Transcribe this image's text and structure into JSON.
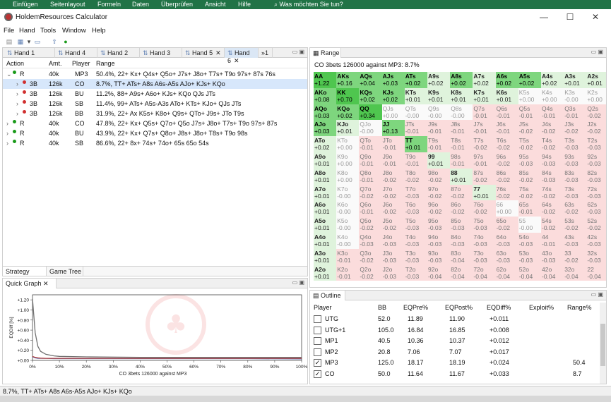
{
  "excel_ribbon": [
    "Einfügen",
    "Seitenlayout",
    "Formeln",
    "Daten",
    "Überprüfen",
    "Ansicht",
    "Hilfe",
    "Was möchten Sie tun?"
  ],
  "window_title": "HoldemResources Calculator",
  "menu": [
    "File",
    "Hand",
    "Tools",
    "Window",
    "Help"
  ],
  "hand_tabs": [
    "Hand 1",
    "Hand 4",
    "Hand 2",
    "Hand 3",
    "Hand 5",
    "Hand 6",
    "»1"
  ],
  "hands_table": {
    "columns": [
      "Action",
      "Amt.",
      "Player",
      "Range"
    ],
    "rows": [
      {
        "action": "R",
        "amt": "40k",
        "player": "MP3",
        "range": "50.4%, 22+ Kx+ Q4s+ Q5o+ J7s+ J8o+ T7s+ T9o 97s+ 87s 76s",
        "indent": 0,
        "expander": "⌄",
        "dot": "#1a9a1a"
      },
      {
        "action": "3B",
        "amt": "126k",
        "player": "CO",
        "range": "8.7%, TT+ ATs+ A8s A6s-A5s AJo+ KJs+ KQo",
        "indent": 1,
        "expander": "›",
        "dot": "#d03030"
      },
      {
        "action": "3B",
        "amt": "126k",
        "player": "BU",
        "range": "11.2%, 88+ A9s+ A6o+ KJs+ KQo QJs JTs",
        "indent": 1,
        "expander": "›",
        "dot": "#d03030"
      },
      {
        "action": "3B",
        "amt": "126k",
        "player": "SB",
        "range": "11.4%, 99+ ATs+ A5s-A3s ATo+ KTs+ KJo+ QJs JTs",
        "indent": 1,
        "expander": "›",
        "dot": "#d03030"
      },
      {
        "action": "3B",
        "amt": "126k",
        "player": "BB",
        "range": "31.9%, 22+ Ax K5s+ K8o+ Q9s+ QTo+ J9s+ JTo T9s",
        "indent": 1,
        "expander": "›",
        "dot": "#d03030"
      },
      {
        "action": "R",
        "amt": "40k",
        "player": "CO",
        "range": "47.8%, 22+ Kx+ Q5s+ Q7o+ Q5o J7s+ J8o+ T7s+ T9o 97s+ 87s",
        "indent": 0,
        "expander": "›",
        "dot": "#1a9a1a"
      },
      {
        "action": "R",
        "amt": "40k",
        "player": "BU",
        "range": "43.9%, 22+ Kx+ Q7s+ Q8o+ J8s+ J8o+ T8s+ T9o 98s",
        "indent": 0,
        "expander": "›",
        "dot": "#1a9a1a"
      },
      {
        "action": "R",
        "amt": "40k",
        "player": "SB",
        "range": "86.6%, 22+ 8x+ 74s+ 74o+ 65s 65o 54s",
        "indent": 0,
        "expander": "›",
        "dot": "#1a9a1a"
      }
    ],
    "selected_row": 1
  },
  "bottom_tabs": [
    "Strategy Table",
    "Game Tree"
  ],
  "quick_graph": {
    "tab_label": "Quick Graph",
    "xlabel": "CO 3bets 126000 against MP3",
    "ylabel": "EQDiff [%]"
  },
  "chart_data": {
    "type": "line",
    "xlabel": "CO 3bets 126000 against MP3",
    "ylabel": "EQDiff [%]",
    "x_ticks": [
      "0%",
      "10%",
      "20%",
      "30%",
      "40%",
      "50%",
      "60%",
      "70%",
      "80%",
      "90%",
      "100%"
    ],
    "y_ticks": [
      "+1.20",
      "+1.00",
      "+0.80",
      "+0.60",
      "+0.40",
      "+0.20",
      "+0.00"
    ],
    "xlim": [
      0,
      100
    ],
    "ylim": [
      0,
      1.3
    ],
    "series": [
      {
        "color": "#707070",
        "x": [
          0,
          1,
          2,
          3,
          5,
          8,
          10,
          20,
          40,
          60,
          80,
          100
        ],
        "y": [
          1.22,
          0.55,
          0.28,
          0.18,
          0.12,
          0.09,
          0.08,
          0.07,
          0.06,
          0.06,
          0.06,
          0.06
        ]
      },
      {
        "color": "#5b6db3",
        "x": [
          0,
          1,
          2,
          3,
          5,
          8,
          10,
          20,
          40,
          60,
          80,
          100
        ],
        "y": [
          0.07,
          0.05,
          0.04,
          0.04,
          0.04,
          0.035,
          0.035,
          0.035,
          0.035,
          0.035,
          0.035,
          0.03
        ]
      },
      {
        "color": "#b04040",
        "x": [
          0,
          1,
          2,
          3,
          5,
          8,
          10,
          20,
          40,
          60,
          80,
          100
        ],
        "y": [
          0.08,
          0.06,
          0.05,
          0.045,
          0.04,
          0.04,
          0.04,
          0.04,
          0.04,
          0.04,
          0.04,
          0.04
        ]
      }
    ]
  },
  "range_panel": {
    "tab_label": "Range",
    "header": "CO 3bets 126000 against MP3: 8.7%",
    "grid": [
      [
        [
          "AA",
          "+1.22"
        ],
        [
          "AKs",
          "+0.16"
        ],
        [
          "AQs",
          "+0.04"
        ],
        [
          "AJs",
          "+0.03"
        ],
        [
          "ATs",
          "+0.02"
        ],
        [
          "A9s",
          "+0.02"
        ],
        [
          "A8s",
          "+0.02"
        ],
        [
          "A7s",
          "+0.02"
        ],
        [
          "A6s",
          "+0.02"
        ],
        [
          "A5s",
          "+0.02"
        ],
        [
          "A4s",
          "+0.02"
        ],
        [
          "A3s",
          "+0.01"
        ],
        [
          "A2s",
          "+0.01"
        ]
      ],
      [
        [
          "AKo",
          "+0.08"
        ],
        [
          "KK",
          "+0.70"
        ],
        [
          "KQs",
          "+0.02"
        ],
        [
          "KJs",
          "+0.02"
        ],
        [
          "KTs",
          "+0.01"
        ],
        [
          "K9s",
          "+0.01"
        ],
        [
          "K8s",
          "+0.01"
        ],
        [
          "K7s",
          "+0.01"
        ],
        [
          "K6s",
          "+0.01"
        ],
        [
          "K5s",
          "+0.00"
        ],
        [
          "K4s",
          "+0.00"
        ],
        [
          "K3s",
          "-0.00"
        ],
        [
          "K2s",
          "+0.00"
        ]
      ],
      [
        [
          "AQo",
          "+0.03"
        ],
        [
          "KQo",
          "+0.02"
        ],
        [
          "QQ",
          "+0.34"
        ],
        [
          "QJs",
          "+0.00"
        ],
        [
          "QTs",
          "-0.00"
        ],
        [
          "Q9s",
          "-0.00"
        ],
        [
          "Q8s",
          "-0.00"
        ],
        [
          "Q7s",
          "-0.01"
        ],
        [
          "Q6s",
          "-0.01"
        ],
        [
          "Q5s",
          "-0.01"
        ],
        [
          "Q4s",
          "-0.01"
        ],
        [
          "Q3s",
          "-0.01"
        ],
        [
          "Q2s",
          "-0.02"
        ]
      ],
      [
        [
          "AJo",
          "+0.03"
        ],
        [
          "KJo",
          "+0.01"
        ],
        [
          "QJo",
          "-0.00"
        ],
        [
          "JJ",
          "+0.13"
        ],
        [
          "JTs",
          "-0.01"
        ],
        [
          "J9s",
          "-0.01"
        ],
        [
          "J8s",
          "-0.01"
        ],
        [
          "J7s",
          "-0.01"
        ],
        [
          "J6s",
          "-0.01"
        ],
        [
          "J5s",
          "-0.02"
        ],
        [
          "J4s",
          "-0.02"
        ],
        [
          "J3s",
          "-0.02"
        ],
        [
          "J2s",
          "-0.02"
        ]
      ],
      [
        [
          "ATo",
          "+0.02"
        ],
        [
          "KTo",
          "+0.00"
        ],
        [
          "QTo",
          "-0.01"
        ],
        [
          "JTo",
          "-0.01"
        ],
        [
          "TT",
          "+0.01"
        ],
        [
          "T9s",
          "-0.01"
        ],
        [
          "T8s",
          "-0.01"
        ],
        [
          "T7s",
          "-0.02"
        ],
        [
          "T6s",
          "-0.02"
        ],
        [
          "T5s",
          "-0.02"
        ],
        [
          "T4s",
          "-0.02"
        ],
        [
          "T3s",
          "-0.03"
        ],
        [
          "T2s",
          "-0.03"
        ]
      ],
      [
        [
          "A9o",
          "+0.01"
        ],
        [
          "K9o",
          "+0.00"
        ],
        [
          "Q9o",
          "-0.01"
        ],
        [
          "J9o",
          "-0.01"
        ],
        [
          "T9o",
          "-0.01"
        ],
        [
          "99",
          "+0.01"
        ],
        [
          "98s",
          "-0.01"
        ],
        [
          "97s",
          "-0.01"
        ],
        [
          "96s",
          "-0.02"
        ],
        [
          "95s",
          "-0.03"
        ],
        [
          "94s",
          "-0.03"
        ],
        [
          "93s",
          "-0.03"
        ],
        [
          "92s",
          "-0.03"
        ]
      ],
      [
        [
          "A8o",
          "+0.01"
        ],
        [
          "K8o",
          "+0.00"
        ],
        [
          "Q8o",
          "-0.01"
        ],
        [
          "J8o",
          "-0.02"
        ],
        [
          "T8o",
          "-0.02"
        ],
        [
          "98o",
          "-0.02"
        ],
        [
          "88",
          "+0.01"
        ],
        [
          "87s",
          "-0.02"
        ],
        [
          "86s",
          "-0.02"
        ],
        [
          "85s",
          "-0.02"
        ],
        [
          "84s",
          "-0.03"
        ],
        [
          "83s",
          "-0.03"
        ],
        [
          "82s",
          "-0.03"
        ]
      ],
      [
        [
          "A7o",
          "+0.01"
        ],
        [
          "K7o",
          "-0.00"
        ],
        [
          "Q7o",
          "-0.02"
        ],
        [
          "J7o",
          "-0.02"
        ],
        [
          "T7o",
          "-0.03"
        ],
        [
          "97o",
          "-0.02"
        ],
        [
          "87o",
          "-0.02"
        ],
        [
          "77",
          "+0.01"
        ],
        [
          "76s",
          "-0.02"
        ],
        [
          "75s",
          "-0.02"
        ],
        [
          "74s",
          "-0.02"
        ],
        [
          "73s",
          "-0.03"
        ],
        [
          "72s",
          "-0.03"
        ]
      ],
      [
        [
          "A6o",
          "+0.01"
        ],
        [
          "K6o",
          "-0.00"
        ],
        [
          "Q6o",
          "-0.01"
        ],
        [
          "J6o",
          "-0.02"
        ],
        [
          "T6o",
          "-0.03"
        ],
        [
          "96o",
          "-0.02"
        ],
        [
          "86o",
          "-0.02"
        ],
        [
          "76o",
          "-0.02"
        ],
        [
          "66",
          "+0.00"
        ],
        [
          "65s",
          "-0.01"
        ],
        [
          "64s",
          "-0.02"
        ],
        [
          "63s",
          "-0.02"
        ],
        [
          "62s",
          "-0.03"
        ]
      ],
      [
        [
          "A5o",
          "+0.01"
        ],
        [
          "K5o",
          "-0.00"
        ],
        [
          "Q5o",
          "-0.02"
        ],
        [
          "J5o",
          "-0.02"
        ],
        [
          "T5o",
          "-0.03"
        ],
        [
          "95o",
          "-0.03"
        ],
        [
          "85o",
          "-0.03"
        ],
        [
          "75o",
          "-0.03"
        ],
        [
          "65o",
          "-0.02"
        ],
        [
          "55",
          "-0.00"
        ],
        [
          "54s",
          "-0.02"
        ],
        [
          "53s",
          "-0.02"
        ],
        [
          "52s",
          "-0.02"
        ]
      ],
      [
        [
          "A4o",
          "+0.01"
        ],
        [
          "K4o",
          "-0.00"
        ],
        [
          "Q4o",
          "-0.03"
        ],
        [
          "J4o",
          "-0.03"
        ],
        [
          "T4o",
          "-0.03"
        ],
        [
          "94o",
          "-0.03"
        ],
        [
          "84o",
          "-0.03"
        ],
        [
          "74o",
          "-0.03"
        ],
        [
          "64o",
          "-0.03"
        ],
        [
          "54o",
          "-0.03"
        ],
        [
          "44",
          "-0.01"
        ],
        [
          "43s",
          "-0.03"
        ],
        [
          "42s",
          "-0.03"
        ]
      ],
      [
        [
          "A3o",
          "+0.01"
        ],
        [
          "K3o",
          "-0.01"
        ],
        [
          "Q3o",
          "-0.02"
        ],
        [
          "J3o",
          "-0.03"
        ],
        [
          "T3o",
          "-0.03"
        ],
        [
          "93o",
          "-0.03"
        ],
        [
          "83o",
          "-0.04"
        ],
        [
          "73o",
          "-0.03"
        ],
        [
          "63o",
          "-0.03"
        ],
        [
          "53o",
          "-0.03"
        ],
        [
          "43o",
          "-0.03"
        ],
        [
          "33",
          "-0.02"
        ],
        [
          "32s",
          "-0.03"
        ]
      ],
      [
        [
          "A2o",
          "+0.01"
        ],
        [
          "K2o",
          "-0.01"
        ],
        [
          "Q2o",
          "-0.02"
        ],
        [
          "J2o",
          "-0.03"
        ],
        [
          "T2o",
          "-0.03"
        ],
        [
          "92o",
          "-0.04"
        ],
        [
          "82o",
          "-0.04"
        ],
        [
          "72o",
          "-0.04"
        ],
        [
          "62o",
          "-0.04"
        ],
        [
          "52o",
          "-0.04"
        ],
        [
          "42o",
          "-0.04"
        ],
        [
          "32o",
          "-0.04"
        ],
        [
          "22",
          "-0.04"
        ]
      ]
    ],
    "in_range": [
      "AA",
      "AKs",
      "AQs",
      "AJs",
      "ATs",
      "A8s",
      "A6s",
      "A5s",
      "AKo",
      "KK",
      "KQs",
      "KJs",
      "AQo",
      "KQo",
      "QQ",
      "AJo",
      "JJ",
      "TT"
    ]
  },
  "outline": {
    "tab_label": "Outline",
    "columns": [
      "Player",
      "BB",
      "EQPre%",
      "EQPost%",
      "EQDiff%",
      "Exploit%",
      "Range%"
    ],
    "rows": [
      {
        "player": "UTG",
        "checked": false,
        "bb": "52.0",
        "eqpre": "11.89",
        "eqpost": "11.90",
        "eqdiff": "+0.011",
        "exploit": "",
        "range": ""
      },
      {
        "player": "UTG+1",
        "checked": false,
        "bb": "105.0",
        "eqpre": "16.84",
        "eqpost": "16.85",
        "eqdiff": "+0.008",
        "exploit": "",
        "range": ""
      },
      {
        "player": "MP1",
        "checked": false,
        "bb": "40.5",
        "eqpre": "10.36",
        "eqpost": "10.37",
        "eqdiff": "+0.012",
        "exploit": "",
        "range": ""
      },
      {
        "player": "MP2",
        "checked": false,
        "bb": "20.8",
        "eqpre": "7.06",
        "eqpost": "7.07",
        "eqdiff": "+0.017",
        "exploit": "",
        "range": ""
      },
      {
        "player": "MP3",
        "checked": true,
        "bb": "125.0",
        "eqpre": "18.17",
        "eqpost": "18.19",
        "eqdiff": "+0.024",
        "exploit": "",
        "range": "50.4"
      },
      {
        "player": "CO",
        "checked": true,
        "bb": "50.0",
        "eqpre": "11.64",
        "eqpost": "11.67",
        "eqdiff": "+0.033",
        "exploit": "",
        "range": "8.7"
      }
    ]
  },
  "status_bar": "8.7%, TT+ ATs+ A8s A6s-A5s AJo+ KJs+ KQo",
  "colors": {
    "in_range_green": "#7ed67e",
    "pos_light_green": "#dff3dc",
    "neg_light_red": "#fbdcdc",
    "selected_row": "#d7e7fb"
  }
}
